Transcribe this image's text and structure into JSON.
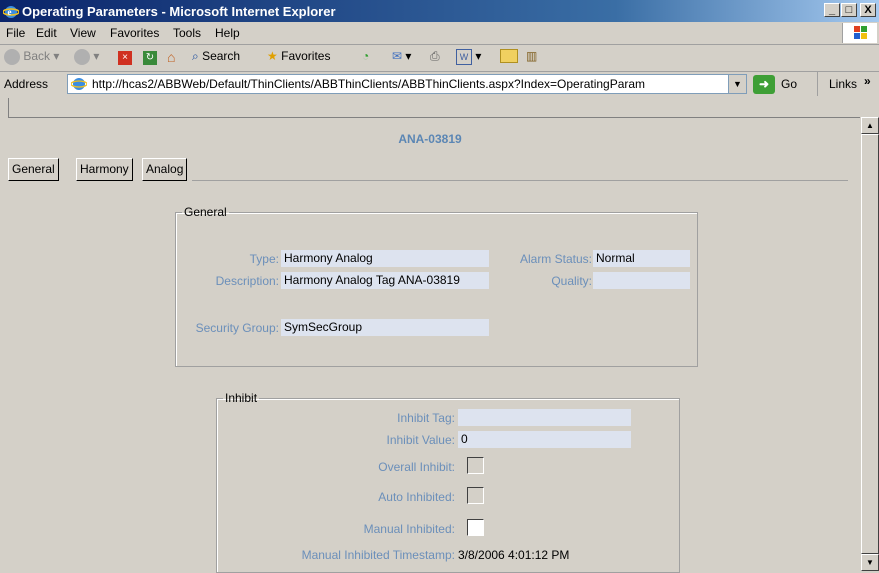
{
  "window": {
    "title": "Operating Parameters - Microsoft Internet Explorer",
    "minimize": "_",
    "maximize": "□",
    "close": "X"
  },
  "menu": {
    "items": [
      {
        "label": "File",
        "underline": "F"
      },
      {
        "label": "Edit",
        "underline": "E"
      },
      {
        "label": "View",
        "underline": "V"
      },
      {
        "label": "Favorites",
        "underline": "a"
      },
      {
        "label": "Tools",
        "underline": "T"
      },
      {
        "label": "Help",
        "underline": "H"
      }
    ]
  },
  "toolbar": {
    "back": "Back",
    "search": "Search",
    "favorites": "Favorites"
  },
  "address": {
    "label": "Address",
    "url": "http://hcas2/ABBWeb/Default/ThinClients/ABBThinClients/ABBThinClients.aspx?Index=OperatingParam",
    "go": "Go",
    "links": "Links",
    "links_more": "»"
  },
  "page": {
    "tag_name": "ANA-03819",
    "tabs": [
      "General",
      "Harmony",
      "Analog"
    ],
    "general": {
      "legend": "General",
      "type_label": "Type:",
      "type_value": "Harmony Analog",
      "description_label": "Description:",
      "description_value": "Harmony Analog Tag ANA-03819",
      "alarm_status_label": "Alarm Status:",
      "alarm_status_value": "Normal",
      "quality_label": "Quality:",
      "quality_value": "",
      "security_group_label": "Security Group:",
      "security_group_value": "SymSecGroup"
    },
    "inhibit": {
      "legend": "Inhibit",
      "inhibit_tag_label": "Inhibit Tag:",
      "inhibit_tag_value": "",
      "inhibit_value_label": "Inhibit Value:",
      "inhibit_value_value": "0",
      "overall_inhibit_label": "Overall Inhibit:",
      "overall_inhibit_checked": false,
      "auto_inhibited_label": "Auto Inhibited:",
      "auto_inhibited_checked": false,
      "manual_inhibited_label": "Manual Inhibited:",
      "manual_inhibited_checked": false,
      "manual_timestamp_label": "Manual Inhibited Timestamp:",
      "manual_timestamp_value": "3/8/2006 4:01:12 PM"
    }
  },
  "colors": {
    "title_gradient_start": "#0a246a",
    "label_blue": "#6b8fba",
    "field_bg": "#dde3ef",
    "window_bg": "#d4d0c8"
  }
}
